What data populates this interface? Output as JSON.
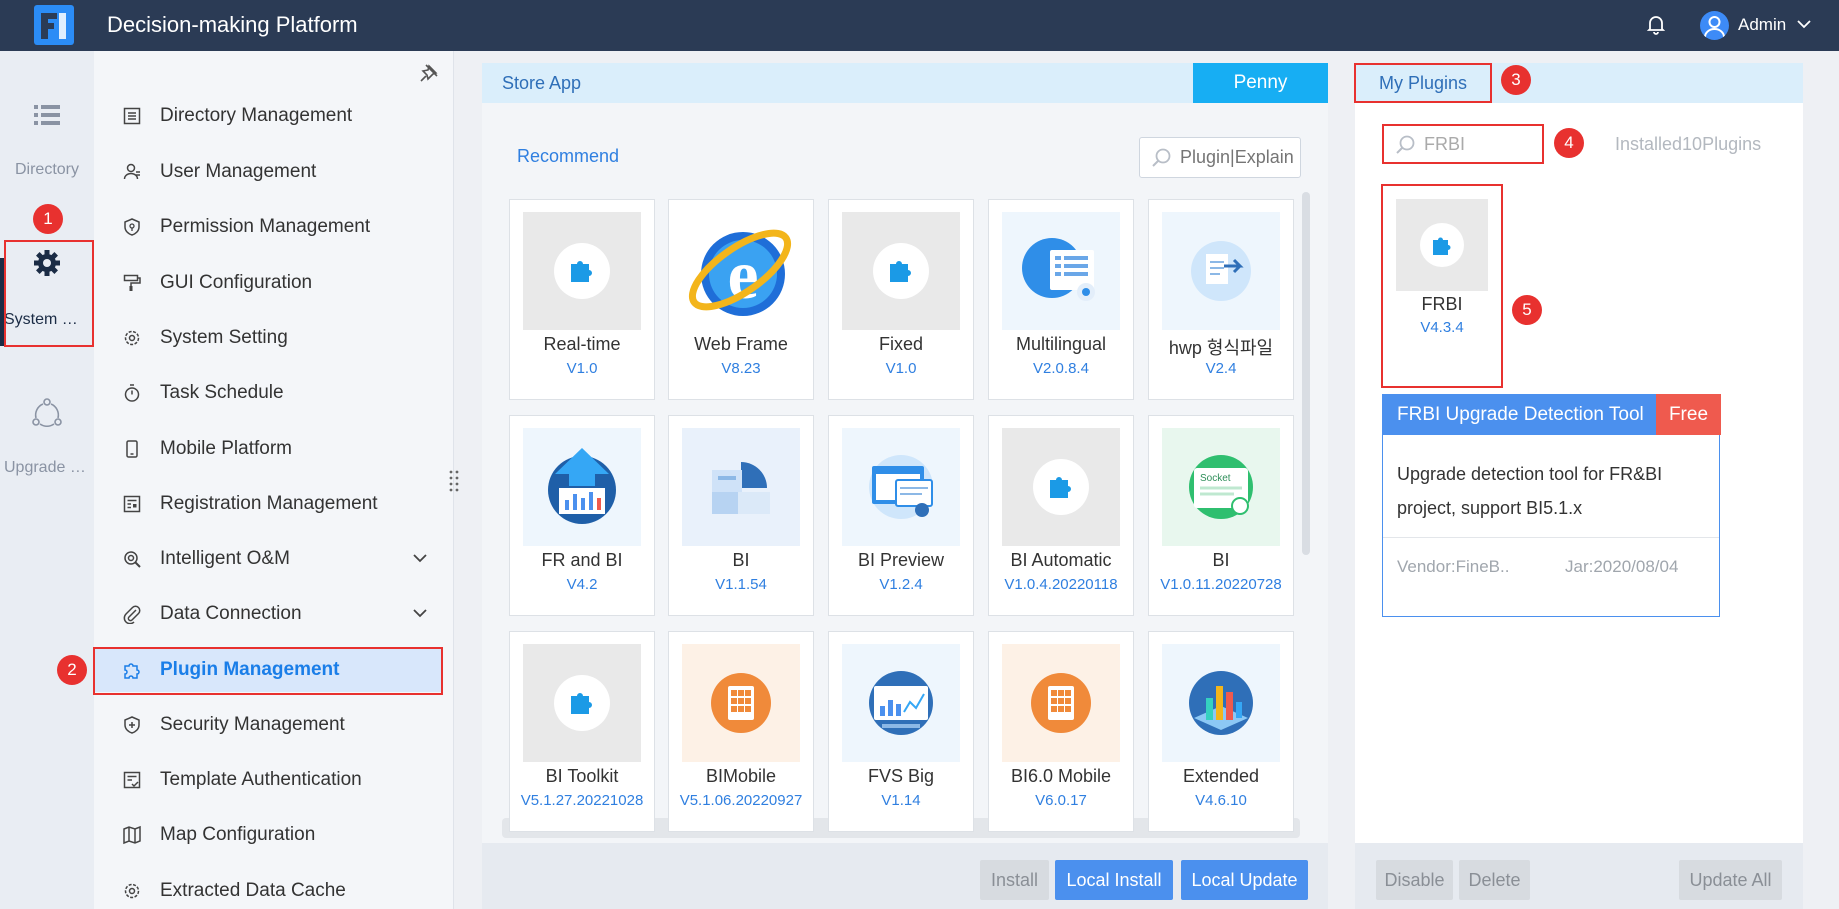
{
  "header": {
    "title": "Decision-making Platform",
    "user": "Admin"
  },
  "rail": {
    "items": [
      {
        "label": "Directory",
        "icon": "list-icon"
      },
      {
        "label": "System Management",
        "icon": "gear-icon",
        "active": true
      },
      {
        "label": "Upgrade Center",
        "icon": "cycle-icon"
      }
    ]
  },
  "menu": {
    "items": [
      {
        "label": "Directory Management"
      },
      {
        "label": "User Management"
      },
      {
        "label": "Permission Management"
      },
      {
        "label": "GUI Configuration"
      },
      {
        "label": "System Setting"
      },
      {
        "label": "Task Schedule"
      },
      {
        "label": "Mobile Platform"
      },
      {
        "label": "Registration Management"
      },
      {
        "label": "Intelligent O&M"
      },
      {
        "label": "Data Connection"
      },
      {
        "label": "Plugin Management"
      },
      {
        "label": "Security Management"
      },
      {
        "label": "Template Authentication"
      },
      {
        "label": "Map Configuration"
      },
      {
        "label": "Extracted Data Cache"
      }
    ]
  },
  "store": {
    "tab_label": "Store App",
    "penny_label": "Penny",
    "recommend_label": "Recommend",
    "search_placeholder": "Plugin|Explain",
    "cards": [
      {
        "name": "Real-time",
        "version": "V1.0"
      },
      {
        "name": "Web Frame",
        "version": "V8.23"
      },
      {
        "name": "Fixed",
        "version": "V1.0"
      },
      {
        "name": "Multilingual",
        "version": "V2.0.8.4"
      },
      {
        "name": "hwp 형식파일",
        "version": "V2.4"
      },
      {
        "name": "FR and BI",
        "version": "V4.2"
      },
      {
        "name": "BI",
        "version": "V1.1.54"
      },
      {
        "name": "BI Preview",
        "version": "V1.2.4"
      },
      {
        "name": "BI Automatic",
        "version": "V1.0.4.20220118"
      },
      {
        "name": "BI",
        "version": "V1.0.11.20220728"
      },
      {
        "name": "BI Toolkit",
        "version": "V5.1.27.20221028"
      },
      {
        "name": "BIMobile",
        "version": "V5.1.06.20220927"
      },
      {
        "name": "FVS Big",
        "version": "V1.14"
      },
      {
        "name": "BI6.0 Mobile",
        "version": "V6.0.17"
      },
      {
        "name": "Extended",
        "version": "V4.6.10"
      }
    ],
    "buttons": {
      "install": "Install",
      "local_install": "Local Install",
      "local_update": "Local Update"
    }
  },
  "my_plugins": {
    "tab_label": "My Plugins",
    "search_value": "FRBI",
    "installed_text": "Installed10Plugins",
    "plugin": {
      "name": "FRBI",
      "version": "V4.3.4"
    },
    "tooltip": {
      "title": "FRBI Upgrade Detection Tool",
      "badge": "Free",
      "description": "Upgrade detection tool for FR&BI project, support BI5.1.x",
      "vendor": "Vendor:FineB..",
      "jar": "Jar:2020/08/04"
    },
    "buttons": {
      "disable": "Disable",
      "delete": "Delete",
      "update_all": "Update All"
    }
  },
  "annotations": [
    "1",
    "2",
    "3",
    "4",
    "5"
  ],
  "colors": {
    "header_bg": "#2b3b55",
    "accent": "#1a7ee8",
    "annotation": "#e8312f"
  }
}
